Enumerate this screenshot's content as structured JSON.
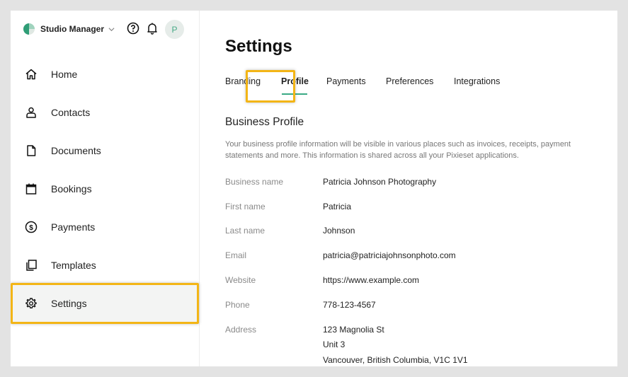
{
  "app": {
    "name": "Studio Manager",
    "avatar_initial": "P",
    "accent": "#3aa984",
    "highlight": "#f3b516"
  },
  "sidebar": {
    "items": [
      {
        "label": "Home",
        "icon": "home-icon"
      },
      {
        "label": "Contacts",
        "icon": "person-icon"
      },
      {
        "label": "Documents",
        "icon": "document-icon"
      },
      {
        "label": "Bookings",
        "icon": "calendar-icon"
      },
      {
        "label": "Payments",
        "icon": "dollar-icon"
      },
      {
        "label": "Templates",
        "icon": "copy-icon"
      },
      {
        "label": "Settings",
        "icon": "gear-icon",
        "active": true
      }
    ]
  },
  "main": {
    "title": "Settings",
    "tabs": [
      {
        "label": "Branding"
      },
      {
        "label": "Profile",
        "active": true
      },
      {
        "label": "Payments"
      },
      {
        "label": "Preferences"
      },
      {
        "label": "Integrations"
      }
    ],
    "section_title": "Business Profile",
    "section_desc": "Your business profile information will be visible in various places such as invoices, receipts, payment statements and more. This information is shared across all your Pixieset applications.",
    "fields": [
      {
        "label": "Business name",
        "value": "Patricia Johnson Photography"
      },
      {
        "label": "First name",
        "value": "Patricia"
      },
      {
        "label": "Last name",
        "value": "Johnson"
      },
      {
        "label": "Email",
        "value": "patricia@patriciajohnsonphoto.com"
      },
      {
        "label": "Website",
        "value": "https://www.example.com"
      },
      {
        "label": "Phone",
        "value": "778-123-4567"
      },
      {
        "label": "Address",
        "value": "123 Magnolia St"
      }
    ],
    "address_extra": [
      "Unit 3",
      "Vancouver, British Columbia, V1C 1V1"
    ]
  }
}
